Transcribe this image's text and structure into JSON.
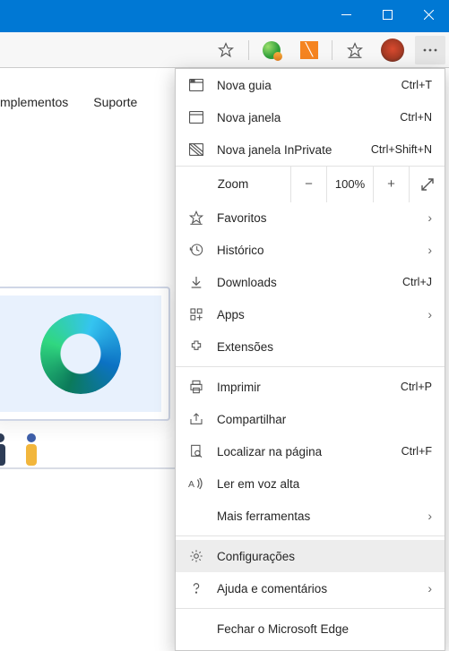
{
  "nav": {
    "items": [
      "mplementos",
      "Suporte"
    ]
  },
  "menu": {
    "new_tab": {
      "label": "Nova guia",
      "shortcut": "Ctrl+T"
    },
    "new_window": {
      "label": "Nova janela",
      "shortcut": "Ctrl+N"
    },
    "new_inprivate": {
      "label": "Nova janela InPrivate",
      "shortcut": "Ctrl+Shift+N"
    },
    "zoom": {
      "label": "Zoom",
      "value": "100%"
    },
    "favorites": {
      "label": "Favoritos"
    },
    "history": {
      "label": "Histórico"
    },
    "downloads": {
      "label": "Downloads",
      "shortcut": "Ctrl+J"
    },
    "apps": {
      "label": "Apps"
    },
    "extensions": {
      "label": "Extensões"
    },
    "print": {
      "label": "Imprimir",
      "shortcut": "Ctrl+P"
    },
    "share": {
      "label": "Compartilhar"
    },
    "find": {
      "label": "Localizar na página",
      "shortcut": "Ctrl+F"
    },
    "read_aloud": {
      "label": "Ler em voz alta"
    },
    "more_tools": {
      "label": "Mais ferramentas"
    },
    "settings": {
      "label": "Configurações"
    },
    "help": {
      "label": "Ajuda e comentários"
    },
    "close": {
      "label": "Fechar o Microsoft Edge"
    }
  }
}
